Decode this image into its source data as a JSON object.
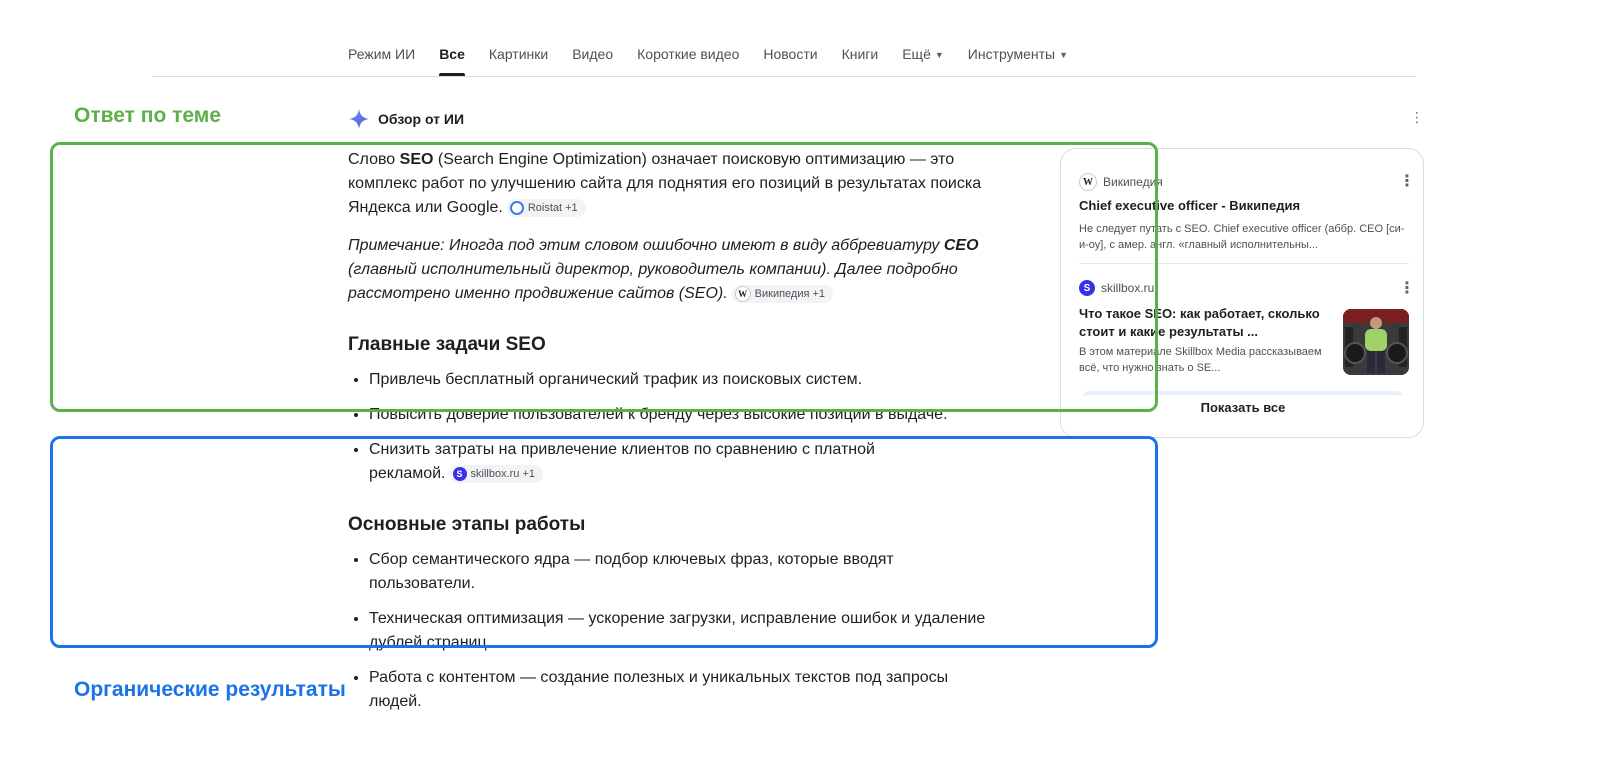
{
  "tabs": [
    {
      "label": "Режим ИИ",
      "active": false,
      "caret": false
    },
    {
      "label": "Все",
      "active": true,
      "caret": false
    },
    {
      "label": "Картинки",
      "active": false,
      "caret": false
    },
    {
      "label": "Видео",
      "active": false,
      "caret": false
    },
    {
      "label": "Короткие видео",
      "active": false,
      "caret": false
    },
    {
      "label": "Новости",
      "active": false,
      "caret": false
    },
    {
      "label": "Книги",
      "active": false,
      "caret": false
    },
    {
      "label": "Ещё",
      "active": false,
      "caret": true
    },
    {
      "label": "Инструменты",
      "active": false,
      "caret": true
    }
  ],
  "annotations": {
    "topic_label": "Ответ по теме",
    "organic_label": "Органические результаты",
    "topic_color": "#5cb04a",
    "organic_color": "#1a73e8"
  },
  "ai_overview": {
    "header": "Обзор от ИИ",
    "p1_before": "Слово ",
    "p1_bold": "SEO",
    "p1_after": " (Search Engine Optimization) означает поисковую оптимизацию — это комплекс работ по улучшению сайта для поднятия его позиций в результатах поиска Яндекса или Google.",
    "p1_chip": "Roistat +1",
    "note_before": "Примечание: Иногда под этим словом ошибочно имеют в виду аббревиатуру ",
    "note_bold": "CEO",
    "note_after": " (главный исполнительный директор, руководитель компании). Далее подробно рассмотрено именно продвижение сайтов (SEO).",
    "note_chip": "Википедия +1",
    "section1_title": "Главные задачи SEO",
    "section1_items": [
      "Привлечь бесплатный органический трафик из поисковых систем.",
      "Повысить доверие пользователей к бренду через высокие позиции в выдаче.",
      "Снизить затраты на привлечение клиентов по сравнению с платной рекламой."
    ],
    "section1_chip": "skillbox.ru +1",
    "section2_title": "Основные этапы работы",
    "section2_items": [
      "Сбор семантического ядра — подбор ключевых фраз, которые вводят пользователи.",
      "Техническая оптимизация — ускорение загрузки, исправление ошибок и удаление дублей страниц.",
      "Работа с контентом — создание полезных и уникальных текстов под запросы людей."
    ]
  },
  "sources_panel": {
    "cards": [
      {
        "source": "Википедия",
        "icon": "wikipedia-icon",
        "title": "Chief executive officer - Википедия",
        "snippet": "Не следует путать с SEO. Chief executive officer (аббр. CEO [си-и-оу], с амер. англ. «главный исполнительны..."
      },
      {
        "source": "skillbox.ru",
        "icon": "skillbox-icon",
        "title": "Что такое SEO: как работает, сколько стоит и какие результаты ...",
        "snippet": "В этом материале Skillbox Media рассказываем всё, что нужно знать о SE..."
      }
    ],
    "show_all": "Показать все"
  },
  "colors": {
    "accent_blue": "#1a73e8",
    "skillbox_purple": "#3b2ee8"
  }
}
